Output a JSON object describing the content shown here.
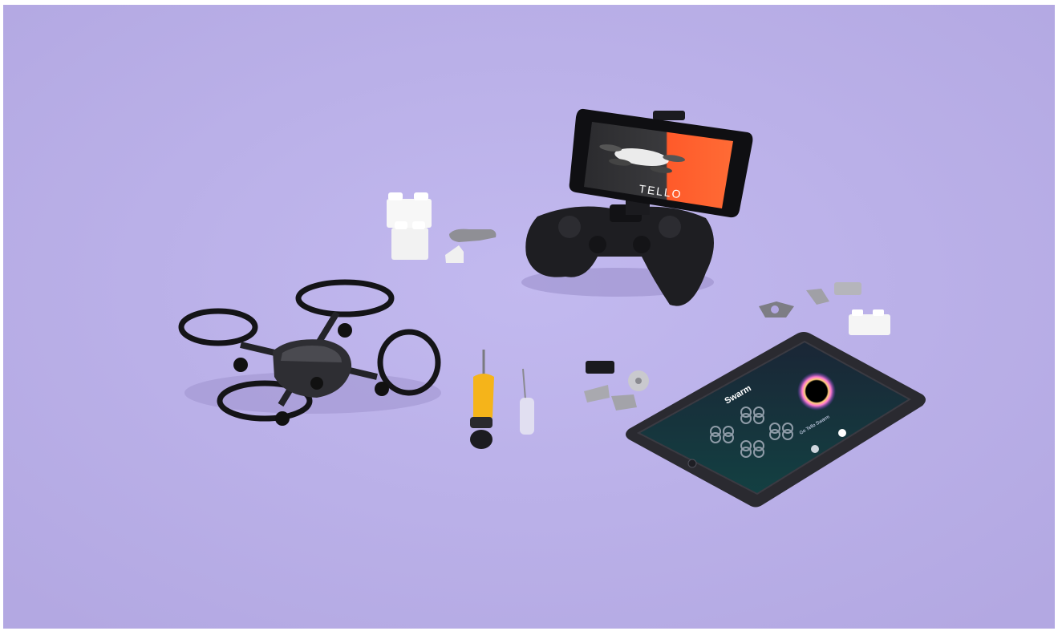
{
  "scene": {
    "background_color": "#bab0e8",
    "frame_color": "#ffffff"
  },
  "phone": {
    "brand_text": "TELLO",
    "accent_color": "#ff5a2a"
  },
  "tablet": {
    "title": "Swarm",
    "caption": "Go Tello Swarm",
    "screen_color": "#13303a"
  },
  "screwdriver": {
    "handle_color": "#f5b41a"
  },
  "icons": [
    "drone-icon",
    "phone-icon",
    "gamepad-icon",
    "tablet-icon",
    "screwdriver-icon",
    "lego-brick-icon"
  ]
}
